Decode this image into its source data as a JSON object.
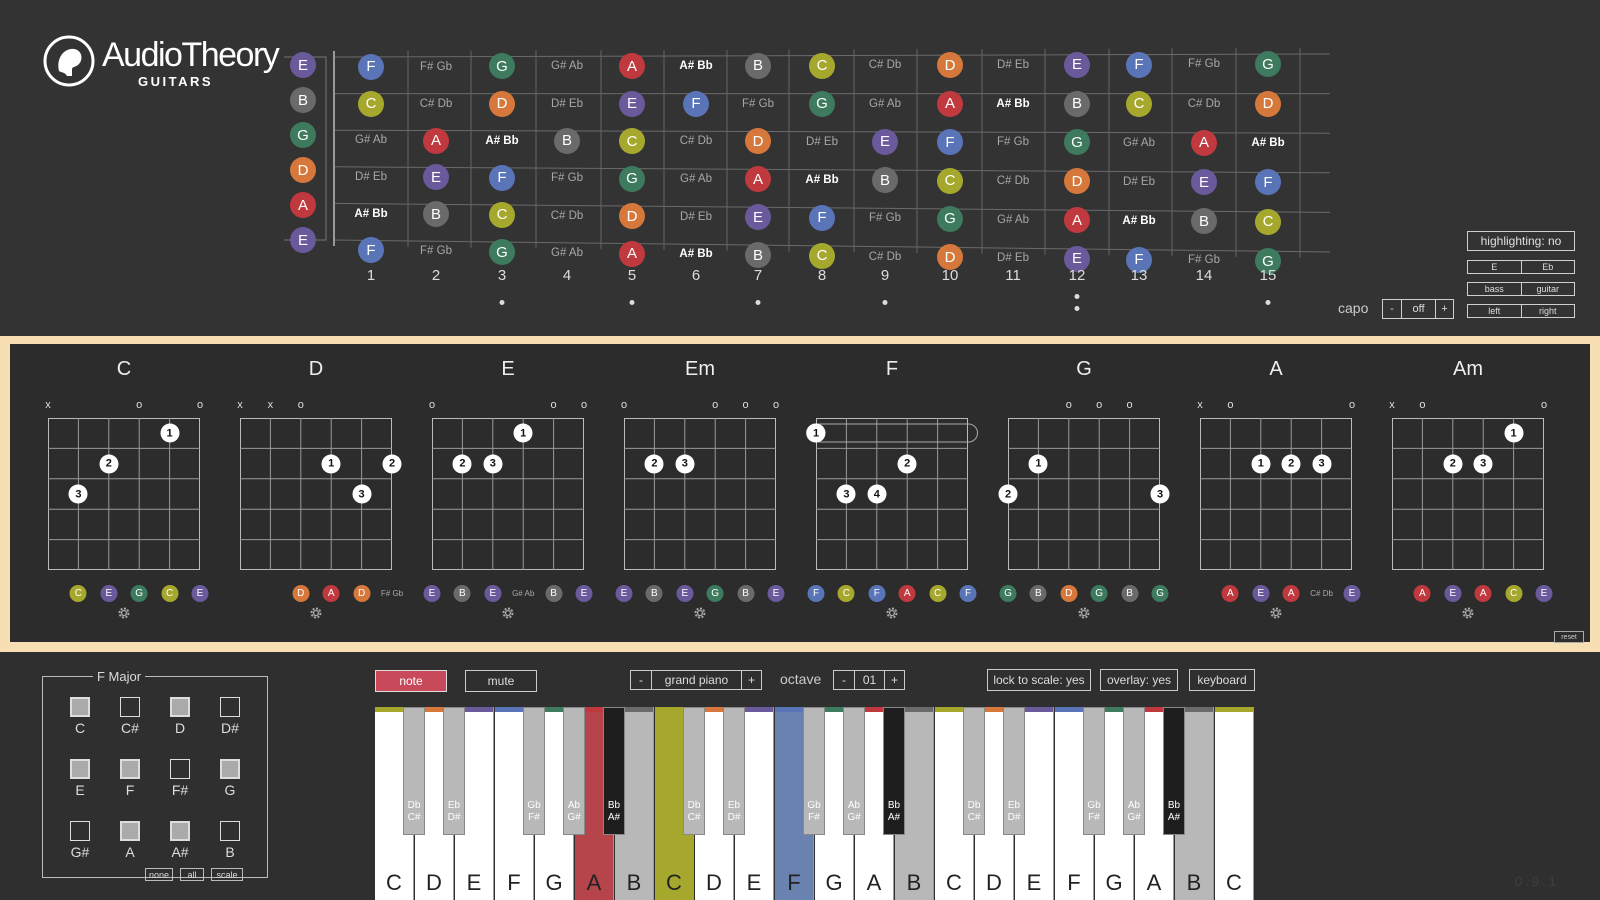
{
  "colors": {
    "E": "#6a5a9c",
    "B": "#6a6a6a",
    "G": "#3d7a5e",
    "D": "#d6783c",
    "A": "#c0393e",
    "F": "#5a74b8",
    "C": "#a6a82e",
    "accent_border": "#f7deb3",
    "note_button": "#c84a5a"
  },
  "logo": {
    "title": "AudioTheory",
    "subtitle": "GUITARS"
  },
  "fretboard": {
    "open_strings": [
      "E",
      "B",
      "G",
      "D",
      "A",
      "E"
    ],
    "frets": [
      [
        "F",
        "C",
        "G# Ab",
        "D# Eb",
        "A# Bb",
        "F"
      ],
      [
        "F# Gb",
        "C# Db",
        "A",
        "E",
        "B",
        "F# Gb"
      ],
      [
        "G",
        "D",
        "A# Bb",
        "F",
        "C",
        "G"
      ],
      [
        "G# Ab",
        "D# Eb",
        "B",
        "F# Gb",
        "C# Db",
        "G# Ab"
      ],
      [
        "A",
        "E",
        "C",
        "G",
        "D",
        "A"
      ],
      [
        "A# Bb",
        "F",
        "C# Db",
        "G# Ab",
        "D# Eb",
        "A# Bb"
      ],
      [
        "B",
        "F# Gb",
        "D",
        "A",
        "E",
        "B"
      ],
      [
        "C",
        "G",
        "D# Eb",
        "A# Bb",
        "F",
        "C"
      ],
      [
        "C# Db",
        "G# Ab",
        "E",
        "B",
        "F# Gb",
        "C# Db"
      ],
      [
        "D",
        "A",
        "F",
        "C",
        "G",
        "D"
      ],
      [
        "D# Eb",
        "A# Bb",
        "F# Gb",
        "C# Db",
        "G# Ab",
        "D# Eb"
      ],
      [
        "E",
        "B",
        "G",
        "D",
        "A",
        "E"
      ],
      [
        "F",
        "C",
        "G# Ab",
        "D# Eb",
        "A# Bb",
        "F"
      ],
      [
        "F# Gb",
        "C# Db",
        "A",
        "E",
        "B",
        "F# Gb"
      ],
      [
        "G",
        "D",
        "A# Bb",
        "F",
        "C",
        "G"
      ]
    ],
    "fret_numbers": [
      "1",
      "2",
      "3",
      "4",
      "5",
      "6",
      "7",
      "8",
      "9",
      "10",
      "11",
      "12",
      "13",
      "14",
      "15"
    ],
    "highlighted_sharps": [
      "A# Bb"
    ]
  },
  "controls": {
    "highlighting": "highlighting: no",
    "tuning": [
      "E",
      "Eb"
    ],
    "instrument": [
      "bass",
      "guitar"
    ],
    "hand": [
      "left",
      "right"
    ],
    "capo_label": "capo",
    "capo_minus": "-",
    "capo_value": "off",
    "capo_plus": "+"
  },
  "chords": [
    {
      "name": "C",
      "opens": [
        "x",
        "",
        "",
        "o",
        "",
        "o"
      ],
      "fingers": [
        {
          "s": 4,
          "f": 1,
          "n": "1"
        },
        {
          "s": 2,
          "f": 2,
          "n": "2"
        },
        {
          "s": 1,
          "f": 3,
          "n": "3"
        }
      ],
      "notes": [
        "C",
        "E",
        "G",
        "C",
        "E"
      ],
      "note_start": 1
    },
    {
      "name": "D",
      "opens": [
        "x",
        "x",
        "o",
        "",
        "",
        ""
      ],
      "fingers": [
        {
          "s": 3,
          "f": 2,
          "n": "1"
        },
        {
          "s": 5,
          "f": 2,
          "n": "2"
        },
        {
          "s": 4,
          "f": 3,
          "n": "3"
        }
      ],
      "notes": [
        "D",
        "A",
        "D",
        "F# Gb"
      ],
      "note_start": 2
    },
    {
      "name": "E",
      "opens": [
        "o",
        "",
        "",
        "",
        "o",
        "o"
      ],
      "fingers": [
        {
          "s": 3,
          "f": 1,
          "n": "1"
        },
        {
          "s": 1,
          "f": 2,
          "n": "2"
        },
        {
          "s": 2,
          "f": 2,
          "n": "3"
        }
      ],
      "notes": [
        "E",
        "B",
        "E",
        "G# Ab",
        "B",
        "E"
      ],
      "note_start": 0
    },
    {
      "name": "Em",
      "opens": [
        "o",
        "",
        "",
        "o",
        "o",
        "o"
      ],
      "fingers": [
        {
          "s": 1,
          "f": 2,
          "n": "2"
        },
        {
          "s": 2,
          "f": 2,
          "n": "3"
        }
      ],
      "notes": [
        "E",
        "B",
        "E",
        "G",
        "B",
        "E"
      ],
      "note_start": 0
    },
    {
      "name": "F",
      "opens": [
        "",
        "",
        "",
        "",
        "",
        ""
      ],
      "barre": true,
      "fingers": [
        {
          "s": 0,
          "f": 1,
          "n": "1"
        },
        {
          "s": 3,
          "f": 2,
          "n": "2"
        },
        {
          "s": 1,
          "f": 3,
          "n": "3"
        },
        {
          "s": 2,
          "f": 3,
          "n": "4"
        }
      ],
      "notes": [
        "F",
        "C",
        "F",
        "A",
        "C",
        "F"
      ],
      "note_start": 0
    },
    {
      "name": "G",
      "opens": [
        "",
        "",
        "o",
        "o",
        "o",
        ""
      ],
      "fingers": [
        {
          "s": 1,
          "f": 2,
          "n": "1"
        },
        {
          "s": 0,
          "f": 3,
          "n": "2"
        },
        {
          "s": 5,
          "f": 3,
          "n": "3"
        }
      ],
      "notes": [
        "G",
        "B",
        "D",
        "G",
        "B",
        "G"
      ],
      "note_start": 0
    },
    {
      "name": "A",
      "opens": [
        "x",
        "o",
        "",
        "",
        "",
        "o"
      ],
      "fingers": [
        {
          "s": 2,
          "f": 2,
          "n": "1"
        },
        {
          "s": 3,
          "f": 2,
          "n": "2"
        },
        {
          "s": 4,
          "f": 2,
          "n": "3"
        }
      ],
      "notes": [
        "A",
        "E",
        "A",
        "C# Db",
        "E"
      ],
      "note_start": 1
    },
    {
      "name": "Am",
      "opens": [
        "x",
        "o",
        "",
        "",
        "",
        "o"
      ],
      "fingers": [
        {
          "s": 4,
          "f": 1,
          "n": "1"
        },
        {
          "s": 2,
          "f": 2,
          "n": "2"
        },
        {
          "s": 3,
          "f": 2,
          "n": "3"
        }
      ],
      "notes": [
        "A",
        "E",
        "A",
        "C",
        "E"
      ],
      "note_start": 1
    }
  ],
  "reset_label": "reset",
  "scale": {
    "title": "F Major",
    "notes": [
      {
        "label": "C",
        "on": true
      },
      {
        "label": "C#",
        "on": false
      },
      {
        "label": "D",
        "on": true
      },
      {
        "label": "D#",
        "on": false
      },
      {
        "label": "E",
        "on": true
      },
      {
        "label": "F",
        "on": true
      },
      {
        "label": "F#",
        "on": false
      },
      {
        "label": "G",
        "on": true
      },
      {
        "label": "G#",
        "on": false
      },
      {
        "label": "A",
        "on": true
      },
      {
        "label": "A#",
        "on": true
      },
      {
        "label": "B",
        "on": false
      }
    ],
    "buttons": [
      "none",
      "all",
      "scale"
    ]
  },
  "player": {
    "note_label": "note",
    "mute_label": "mute",
    "instrument_minus": "-",
    "instrument": "grand piano",
    "instrument_plus": "+",
    "octave_label": "octave",
    "octave_minus": "-",
    "octave_value": "01",
    "octave_plus": "+",
    "lock_label": "lock to scale: yes",
    "overlay_label": "overlay: yes",
    "keyboard_label": "keyboard"
  },
  "piano": {
    "white_keys": [
      "C",
      "D",
      "E",
      "F",
      "G",
      "A",
      "B",
      "C",
      "D",
      "E",
      "F",
      "G",
      "A",
      "B",
      "C",
      "D",
      "E",
      "F",
      "G",
      "A",
      "B",
      "C"
    ],
    "white_fill": [
      "",
      "",
      "",
      "",
      "",
      "#b5454a",
      "#b8b8b8",
      "#a6a82e",
      "",
      "",
      "#6a82b0",
      "",
      "",
      "#b8b8b8",
      "",
      "",
      "",
      "",
      "",
      "",
      "#b8b8b8",
      ""
    ],
    "black_keys": [
      {
        "after": 0,
        "label": "Db\nC#",
        "dark": false
      },
      {
        "after": 1,
        "label": "Eb\nD#",
        "dark": false
      },
      {
        "after": 3,
        "label": "Gb\nF#",
        "dark": false
      },
      {
        "after": 4,
        "label": "Ab\nG#",
        "dark": false
      },
      {
        "after": 5,
        "label": "Bb\nA#",
        "dark": true
      },
      {
        "after": 7,
        "label": "Db\nC#",
        "dark": false
      },
      {
        "after": 8,
        "label": "Eb\nD#",
        "dark": false
      },
      {
        "after": 10,
        "label": "Gb\nF#",
        "dark": false
      },
      {
        "after": 11,
        "label": "Ab\nG#",
        "dark": false
      },
      {
        "after": 12,
        "label": "Bb\nA#",
        "dark": true
      },
      {
        "after": 14,
        "label": "Db\nC#",
        "dark": false
      },
      {
        "after": 15,
        "label": "Eb\nD#",
        "dark": false
      },
      {
        "after": 17,
        "label": "Gb\nF#",
        "dark": false
      },
      {
        "after": 18,
        "label": "Ab\nG#",
        "dark": false
      },
      {
        "after": 19,
        "label": "Bb\nA#",
        "dark": true
      }
    ]
  },
  "version": "0.9.1"
}
